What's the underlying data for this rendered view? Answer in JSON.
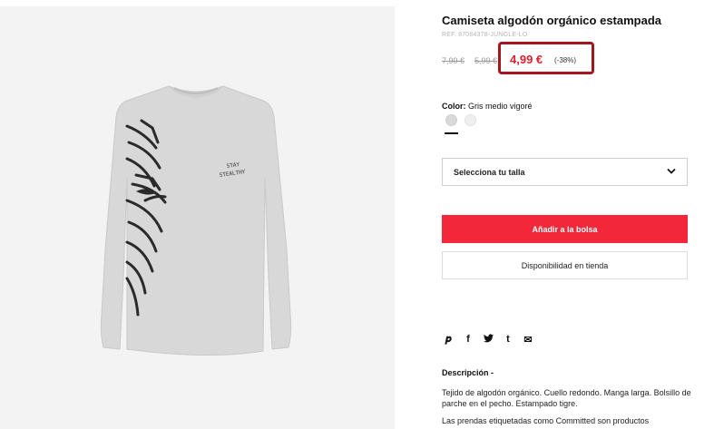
{
  "product": {
    "title": "Camiseta algodón orgánico estampada",
    "ref": "REF. 87084378-JUNGLE-LO",
    "old_prices": [
      "7,99 €",
      "5,99 €"
    ],
    "price": "4,99 €",
    "discount": "(-38%)",
    "image_print_text": "STAY\nSTEALTHY"
  },
  "color": {
    "label": "Color:",
    "value": "Gris medio vigoré",
    "swatches": [
      "#d9d9d9",
      "#efefef"
    ]
  },
  "size_select": {
    "label": "Selecciona tu talla"
  },
  "actions": {
    "add_to_bag": "Añadir a la bolsa",
    "store_availability": "Disponibilidad en tienda"
  },
  "share": {
    "icons": [
      "pinterest-icon",
      "facebook-icon",
      "twitter-icon",
      "tumblr-icon",
      "email-icon"
    ],
    "glyphs": [
      "𝒑",
      "f",
      "🐦",
      "t",
      "✉"
    ]
  },
  "description": {
    "title": "Descripción -",
    "body": "Tejido de algodón orgánico. Cuello redondo. Manga larga. Bolsillo de parche en el pecho. Estampado tigre.",
    "more": "Las prendas etiquetadas como Committed son productos"
  },
  "colors": {
    "accent_red": "#f2283a",
    "price_red": "#e0202e",
    "highlight_border": "#a3161c"
  }
}
